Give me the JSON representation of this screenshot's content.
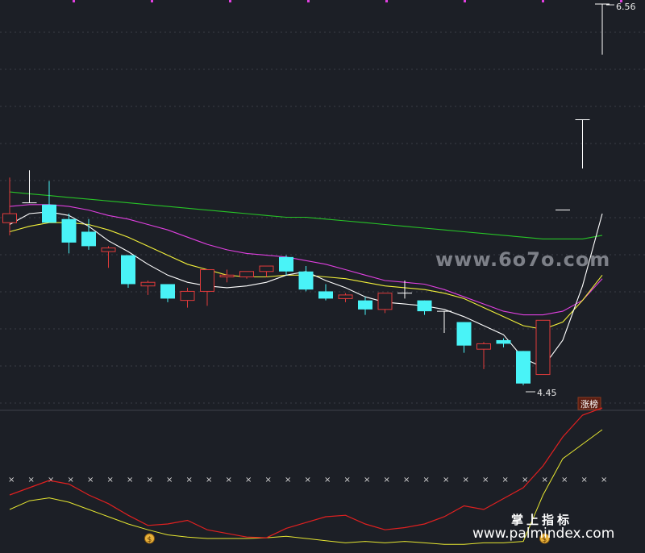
{
  "labels": {
    "high": "6.56",
    "low": "4.45",
    "badge": "涨榜"
  },
  "watermarks": {
    "site1": "www.6o7o.com",
    "site2": "www.palmindex.com",
    "brand": "掌上指标"
  },
  "colors": {
    "background": "#1c1f26",
    "up": "#e23b3b",
    "down": "#49f3f7",
    "ma5": "#ffffff",
    "ma10": "#f2f03a",
    "ma20": "#e040e0",
    "ma60": "#27c427",
    "lower_red": "#e02020",
    "lower_yellow": "#e6e631",
    "cross": "#d8d8d8",
    "top_ticks": "#e040e0"
  },
  "chart_data": {
    "type": "candlestick",
    "ylim": [
      4.3,
      6.6
    ],
    "candles": [
      {
        "o": 5.35,
        "h": 5.6,
        "l": 5.28,
        "c": 5.4
      },
      {
        "o": 5.46,
        "h": 5.64,
        "l": 5.46,
        "c": 5.46
      },
      {
        "o": 5.45,
        "h": 5.58,
        "l": 5.36,
        "c": 5.35
      },
      {
        "o": 5.37,
        "h": 5.4,
        "l": 5.18,
        "c": 5.24
      },
      {
        "o": 5.3,
        "h": 5.37,
        "l": 5.2,
        "c": 5.22
      },
      {
        "o": 5.19,
        "h": 5.22,
        "l": 5.1,
        "c": 5.21
      },
      {
        "o": 5.17,
        "h": 5.17,
        "l": 4.99,
        "c": 5.01
      },
      {
        "o": 5.0,
        "h": 5.03,
        "l": 4.95,
        "c": 5.02
      },
      {
        "o": 5.01,
        "h": 5.01,
        "l": 4.91,
        "c": 4.93
      },
      {
        "o": 4.92,
        "h": 4.99,
        "l": 4.88,
        "c": 4.97
      },
      {
        "o": 4.97,
        "h": 5.09,
        "l": 4.89,
        "c": 5.09
      },
      {
        "o": 5.05,
        "h": 5.09,
        "l": 5.02,
        "c": 5.06
      },
      {
        "o": 5.05,
        "h": 5.07,
        "l": 5.04,
        "c": 5.08
      },
      {
        "o": 5.08,
        "h": 5.11,
        "l": 5.05,
        "c": 5.11
      },
      {
        "o": 5.16,
        "h": 5.17,
        "l": 5.06,
        "c": 5.08
      },
      {
        "o": 5.08,
        "h": 5.11,
        "l": 4.97,
        "c": 4.98
      },
      {
        "o": 4.97,
        "h": 5.01,
        "l": 4.92,
        "c": 4.93
      },
      {
        "o": 4.93,
        "h": 4.96,
        "l": 4.91,
        "c": 4.95
      },
      {
        "o": 4.92,
        "h": 4.94,
        "l": 4.84,
        "c": 4.87
      },
      {
        "o": 4.87,
        "h": 4.96,
        "l": 4.85,
        "c": 4.96
      },
      {
        "o": 4.96,
        "h": 5.03,
        "l": 4.93,
        "c": 4.96
      },
      {
        "o": 4.92,
        "h": 4.92,
        "l": 4.84,
        "c": 4.86
      },
      {
        "o": 4.86,
        "h": 4.86,
        "l": 4.74,
        "c": 4.86
      },
      {
        "o": 4.8,
        "h": 4.8,
        "l": 4.63,
        "c": 4.67
      },
      {
        "o": 4.65,
        "h": 4.69,
        "l": 4.54,
        "c": 4.68
      },
      {
        "o": 4.7,
        "h": 4.71,
        "l": 4.66,
        "c": 4.68
      },
      {
        "o": 4.64,
        "h": 4.64,
        "l": 4.45,
        "c": 4.46
      },
      {
        "o": 4.51,
        "h": 4.81,
        "l": 4.51,
        "c": 4.81
      },
      {
        "o": 5.42,
        "h": 5.42,
        "l": 5.42,
        "c": 5.42
      },
      {
        "o": 5.92,
        "h": 5.92,
        "l": 5.65,
        "c": 5.92
      },
      {
        "o": 6.56,
        "h": 6.56,
        "l": 6.28,
        "c": 6.56
      }
    ],
    "ma5": [
      5.34,
      5.4,
      5.41,
      5.39,
      5.33,
      5.25,
      5.19,
      5.12,
      5.06,
      5.02,
      5.0,
      4.99,
      5.0,
      5.02,
      5.06,
      5.08,
      5.03,
      4.99,
      4.94,
      4.91,
      4.9,
      4.89,
      4.87,
      4.83,
      4.78,
      4.73,
      4.6,
      4.55,
      4.7,
      5.0,
      5.4
    ],
    "ma10": [
      5.3,
      5.33,
      5.35,
      5.35,
      5.34,
      5.31,
      5.27,
      5.22,
      5.17,
      5.12,
      5.09,
      5.06,
      5.05,
      5.05,
      5.06,
      5.06,
      5.05,
      5.04,
      5.02,
      5.0,
      4.99,
      4.98,
      4.96,
      4.93,
      4.88,
      4.83,
      4.78,
      4.76,
      4.8,
      4.92,
      5.06
    ],
    "ma20": [
      5.44,
      5.45,
      5.45,
      5.44,
      5.42,
      5.39,
      5.37,
      5.34,
      5.31,
      5.27,
      5.23,
      5.2,
      5.18,
      5.17,
      5.16,
      5.14,
      5.12,
      5.09,
      5.06,
      5.03,
      5.02,
      5.01,
      4.98,
      4.94,
      4.9,
      4.86,
      4.84,
      4.84,
      4.86,
      4.92,
      5.04
    ],
    "ma60": [
      5.52,
      5.51,
      5.5,
      5.49,
      5.48,
      5.47,
      5.46,
      5.45,
      5.44,
      5.43,
      5.42,
      5.41,
      5.4,
      5.39,
      5.38,
      5.38,
      5.37,
      5.36,
      5.35,
      5.34,
      5.33,
      5.32,
      5.31,
      5.3,
      5.29,
      5.28,
      5.27,
      5.26,
      5.26,
      5.26,
      5.28
    ],
    "lower": {
      "red": [
        560,
        570,
        580,
        575,
        560,
        548,
        532,
        518,
        520,
        525,
        512,
        507,
        502,
        501,
        514,
        522,
        530,
        532,
        520,
        512,
        515,
        520,
        530,
        545,
        540,
        555,
        570,
        600,
        640,
        670,
        680
      ],
      "yellow": [
        540,
        552,
        556,
        550,
        540,
        530,
        520,
        512,
        505,
        502,
        500,
        500,
        500,
        501,
        503,
        500,
        497,
        494,
        496,
        494,
        496,
        494,
        492,
        492,
        494,
        494,
        496,
        560,
        610,
        630,
        650
      ],
      "markers_x": [
        7,
        27
      ]
    }
  }
}
